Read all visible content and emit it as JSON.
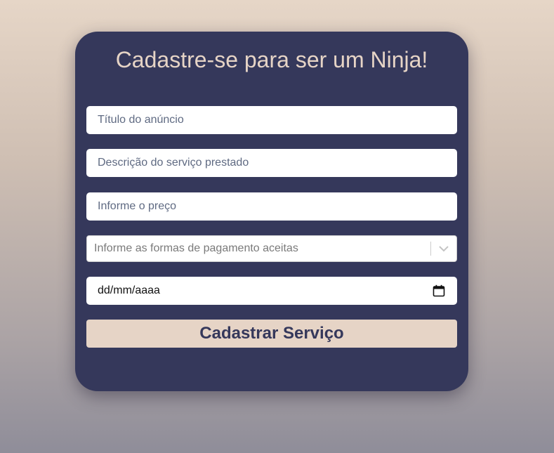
{
  "form": {
    "title": "Cadastre-se para ser um Ninja!",
    "fields": [
      {
        "placeholder": "Título do anúncio"
      },
      {
        "placeholder": "Descrição do serviço prestado"
      },
      {
        "placeholder": "Informe o preço"
      }
    ],
    "payment_select": {
      "placeholder": "Informe as formas de pagamento aceitas",
      "icon": "chevron-down-icon"
    },
    "date_input": {
      "value": "dd/mm/aaaa",
      "icon": "calendar-icon"
    },
    "submit_label": "Cadastrar Serviço"
  },
  "colors": {
    "card": "#35385b",
    "accent": "#e6d4c6",
    "field_bg": "#ffffff"
  }
}
